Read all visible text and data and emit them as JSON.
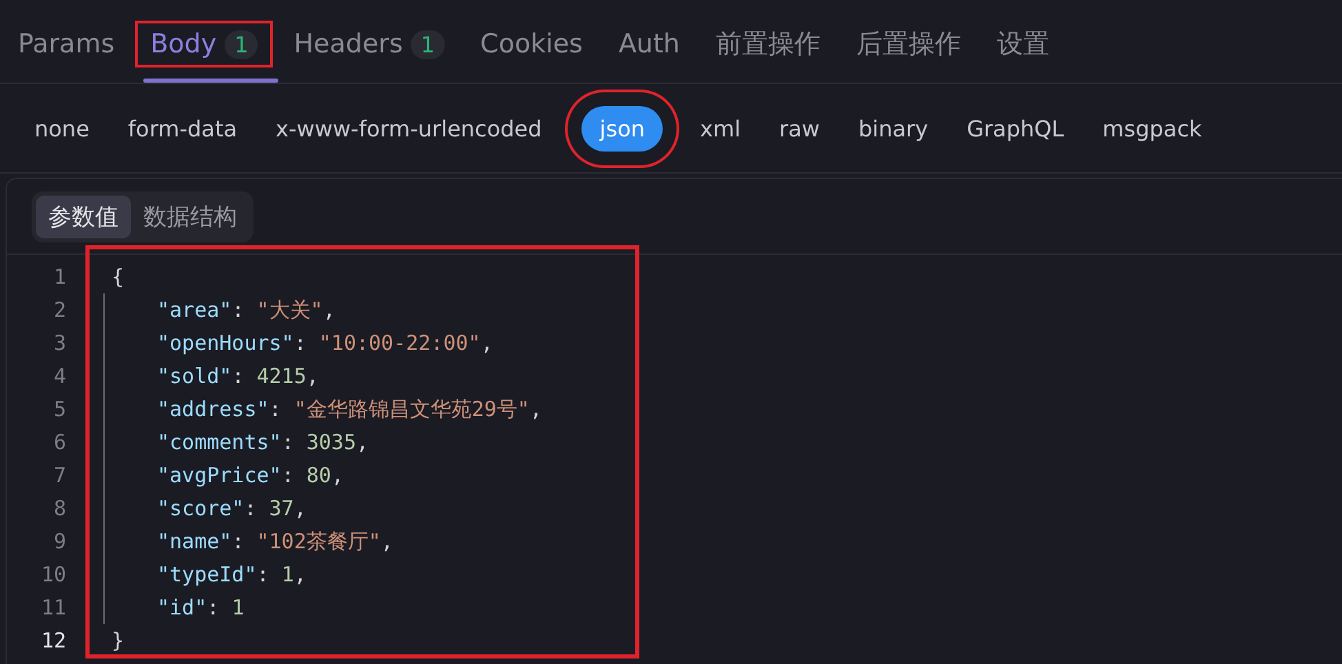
{
  "tabs": [
    {
      "label": "Params",
      "selected": false,
      "highlighted": false
    },
    {
      "label": "Body",
      "count": "1",
      "selected": true,
      "highlighted": true
    },
    {
      "label": "Headers",
      "count": "1",
      "selected": false,
      "highlighted": false
    },
    {
      "label": "Cookies",
      "selected": false,
      "highlighted": false
    },
    {
      "label": "Auth",
      "selected": false,
      "highlighted": false
    },
    {
      "label": "前置操作",
      "selected": false,
      "highlighted": false
    },
    {
      "label": "后置操作",
      "selected": false,
      "highlighted": false
    },
    {
      "label": "设置",
      "selected": false,
      "highlighted": false
    }
  ],
  "body_types": [
    {
      "label": "none",
      "selected": false,
      "highlighted": false
    },
    {
      "label": "form-data",
      "selected": false,
      "highlighted": false
    },
    {
      "label": "x-www-form-urlencoded",
      "selected": false,
      "highlighted": false
    },
    {
      "label": "json",
      "selected": true,
      "highlighted": true
    },
    {
      "label": "xml",
      "selected": false,
      "highlighted": false
    },
    {
      "label": "raw",
      "selected": false,
      "highlighted": false
    },
    {
      "label": "binary",
      "selected": false,
      "highlighted": false
    },
    {
      "label": "GraphQL",
      "selected": false,
      "highlighted": false
    },
    {
      "label": "msgpack",
      "selected": false,
      "highlighted": false
    }
  ],
  "view_switch": [
    {
      "label": "参数值",
      "selected": true
    },
    {
      "label": "数据结构",
      "selected": false
    }
  ],
  "editor": {
    "highlighted": true,
    "lines": [
      {
        "number": "1",
        "active": false,
        "tokens": [
          {
            "kind": "punct",
            "text": "{"
          }
        ]
      },
      {
        "number": "2",
        "active": false,
        "tokens": [
          {
            "kind": "key",
            "text": "\"area\""
          },
          {
            "kind": "punct",
            "text": ": "
          },
          {
            "kind": "string",
            "text": "\"大关\""
          },
          {
            "kind": "punct",
            "text": ","
          }
        ]
      },
      {
        "number": "3",
        "active": false,
        "tokens": [
          {
            "kind": "key",
            "text": "\"openHours\""
          },
          {
            "kind": "punct",
            "text": ": "
          },
          {
            "kind": "string",
            "text": "\"10:00-22:00\""
          },
          {
            "kind": "punct",
            "text": ","
          }
        ]
      },
      {
        "number": "4",
        "active": false,
        "tokens": [
          {
            "kind": "key",
            "text": "\"sold\""
          },
          {
            "kind": "punct",
            "text": ": "
          },
          {
            "kind": "number",
            "text": "4215"
          },
          {
            "kind": "punct",
            "text": ","
          }
        ]
      },
      {
        "number": "5",
        "active": false,
        "tokens": [
          {
            "kind": "key",
            "text": "\"address\""
          },
          {
            "kind": "punct",
            "text": ": "
          },
          {
            "kind": "string",
            "text": "\"金华路锦昌文华苑29号\""
          },
          {
            "kind": "punct",
            "text": ","
          }
        ]
      },
      {
        "number": "6",
        "active": false,
        "tokens": [
          {
            "kind": "key",
            "text": "\"comments\""
          },
          {
            "kind": "punct",
            "text": ": "
          },
          {
            "kind": "number",
            "text": "3035"
          },
          {
            "kind": "punct",
            "text": ","
          }
        ]
      },
      {
        "number": "7",
        "active": false,
        "tokens": [
          {
            "kind": "key",
            "text": "\"avgPrice\""
          },
          {
            "kind": "punct",
            "text": ": "
          },
          {
            "kind": "number",
            "text": "80"
          },
          {
            "kind": "punct",
            "text": ","
          }
        ]
      },
      {
        "number": "8",
        "active": false,
        "tokens": [
          {
            "kind": "key",
            "text": "\"score\""
          },
          {
            "kind": "punct",
            "text": ": "
          },
          {
            "kind": "number",
            "text": "37"
          },
          {
            "kind": "punct",
            "text": ","
          }
        ]
      },
      {
        "number": "9",
        "active": false,
        "tokens": [
          {
            "kind": "key",
            "text": "\"name\""
          },
          {
            "kind": "punct",
            "text": ": "
          },
          {
            "kind": "string",
            "text": "\"102茶餐厅\""
          },
          {
            "kind": "punct",
            "text": ","
          }
        ]
      },
      {
        "number": "10",
        "active": false,
        "tokens": [
          {
            "kind": "key",
            "text": "\"typeId\""
          },
          {
            "kind": "punct",
            "text": ": "
          },
          {
            "kind": "number",
            "text": "1"
          },
          {
            "kind": "punct",
            "text": ","
          }
        ]
      },
      {
        "number": "11",
        "active": false,
        "tokens": [
          {
            "kind": "key",
            "text": "\"id\""
          },
          {
            "kind": "punct",
            "text": ": "
          },
          {
            "kind": "number",
            "text": "1"
          }
        ]
      },
      {
        "number": "12",
        "active": true,
        "tokens": [
          {
            "kind": "punct",
            "text": "}"
          }
        ]
      }
    ]
  }
}
